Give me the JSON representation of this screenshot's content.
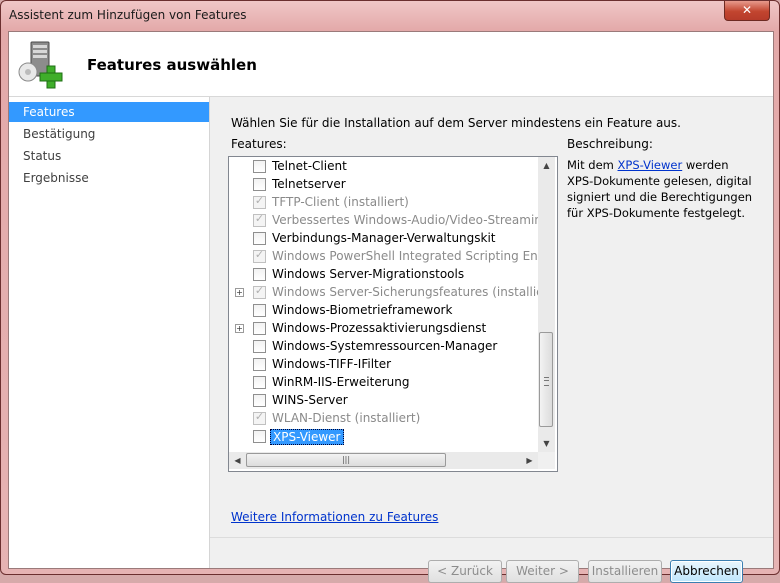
{
  "window": {
    "title": "Assistent zum Hinzufügen von Features",
    "close_glyph": "✕"
  },
  "header": {
    "title": "Features auswählen",
    "icon": "server-add-icon"
  },
  "nav": {
    "items": [
      {
        "label": "Features",
        "active": true
      },
      {
        "label": "Bestätigung",
        "active": false
      },
      {
        "label": "Status",
        "active": false
      },
      {
        "label": "Ergebnisse",
        "active": false
      }
    ]
  },
  "main": {
    "instruction": "Wählen Sie für die Installation auf dem Server mindestens ein Feature aus.",
    "features_label": "Features:",
    "description_label": "Beschreibung:",
    "description_prefix": "Mit dem ",
    "description_link": "XPS-Viewer",
    "description_suffix": " werden XPS-Dokumente gelesen, digital signiert und die Berechtigungen für XPS-Dokumente festgelegt.",
    "more_info_link": "Weitere Informationen zu Features"
  },
  "features": [
    {
      "label": "Telnet-Client",
      "checked": false,
      "disabled": false,
      "expander": false
    },
    {
      "label": "Telnetserver",
      "checked": false,
      "disabled": false,
      "expander": false
    },
    {
      "label": "TFTP-Client (installiert)",
      "checked": true,
      "disabled": true,
      "expander": false
    },
    {
      "label": "Verbessertes Windows-Audio/Video-Streaming (in",
      "checked": true,
      "disabled": true,
      "expander": false
    },
    {
      "label": "Verbindungs-Manager-Verwaltungskit",
      "checked": false,
      "disabled": false,
      "expander": false
    },
    {
      "label": "Windows PowerShell Integrated Scripting Environn",
      "checked": true,
      "disabled": true,
      "expander": false
    },
    {
      "label": "Windows Server-Migrationstools",
      "checked": false,
      "disabled": false,
      "expander": false
    },
    {
      "label": "Windows Server-Sicherungsfeatures (installiert)",
      "checked": true,
      "disabled": true,
      "expander": true
    },
    {
      "label": "Windows-Biometrieframework",
      "checked": false,
      "disabled": false,
      "expander": false
    },
    {
      "label": "Windows-Prozessaktivierungsdienst",
      "checked": false,
      "disabled": false,
      "expander": true
    },
    {
      "label": "Windows-Systemressourcen-Manager",
      "checked": false,
      "disabled": false,
      "expander": false
    },
    {
      "label": "Windows-TIFF-IFilter",
      "checked": false,
      "disabled": false,
      "expander": false
    },
    {
      "label": "WinRM-IIS-Erweiterung",
      "checked": false,
      "disabled": false,
      "expander": false
    },
    {
      "label": "WINS-Server",
      "checked": false,
      "disabled": false,
      "expander": false
    },
    {
      "label": "WLAN-Dienst (installiert)",
      "checked": true,
      "disabled": true,
      "expander": false
    },
    {
      "label": "XPS-Viewer",
      "checked": false,
      "disabled": false,
      "expander": false,
      "selected": true
    }
  ],
  "buttons": {
    "back": "< Zurück",
    "next": "Weiter >",
    "install": "Installieren",
    "cancel": "Abbrechen"
  }
}
